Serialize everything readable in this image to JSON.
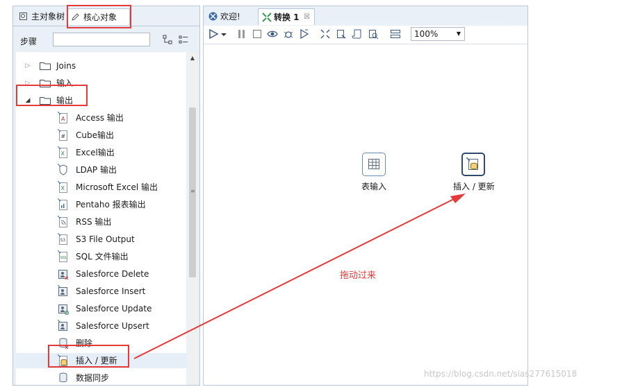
{
  "left_panel": {
    "tabs": [
      {
        "label": "主对象树",
        "icon": "tree-icon"
      },
      {
        "label": "核心对象",
        "icon": "pencil-icon"
      }
    ],
    "steps_label": "步骤",
    "tree": [
      {
        "type": "folder",
        "label": "Joins",
        "expanded": false
      },
      {
        "type": "folder",
        "label": "输入",
        "expanded": false
      },
      {
        "type": "folder",
        "label": "输出",
        "expanded": true
      },
      {
        "type": "step",
        "label": "Access 输出",
        "icon": "access-output-icon"
      },
      {
        "type": "step",
        "label": "Cube输出",
        "icon": "cube-output-icon"
      },
      {
        "type": "step",
        "label": "Excel输出",
        "icon": "excel-output-icon"
      },
      {
        "type": "step",
        "label": "LDAP 输出",
        "icon": "ldap-output-icon"
      },
      {
        "type": "step",
        "label": "Microsoft Excel 输出",
        "icon": "ms-excel-output-icon"
      },
      {
        "type": "step",
        "label": "Pentaho 报表输出",
        "icon": "report-output-icon"
      },
      {
        "type": "step",
        "label": "RSS 输出",
        "icon": "rss-output-icon"
      },
      {
        "type": "step",
        "label": "S3 File Output",
        "icon": "s3-output-icon"
      },
      {
        "type": "step",
        "label": "SQL 文件输出",
        "icon": "sql-output-icon"
      },
      {
        "type": "step",
        "label": "Salesforce Delete",
        "icon": "salesforce-delete-icon"
      },
      {
        "type": "step",
        "label": "Salesforce Insert",
        "icon": "salesforce-insert-icon"
      },
      {
        "type": "step",
        "label": "Salesforce Update",
        "icon": "salesforce-update-icon"
      },
      {
        "type": "step",
        "label": "Salesforce Upsert",
        "icon": "salesforce-upsert-icon"
      },
      {
        "type": "step",
        "label": "删除",
        "icon": "delete-step-icon"
      },
      {
        "type": "step",
        "label": "插入 / 更新",
        "icon": "insert-update-icon"
      },
      {
        "type": "step",
        "label": "数据同步",
        "icon": "sync-icon"
      }
    ]
  },
  "right_panel": {
    "tabs": [
      {
        "label": "欢迎!",
        "icon": "spoon-icon"
      },
      {
        "label": "转换 1",
        "icon": "transformation-icon",
        "close": "☒"
      }
    ],
    "zoom": "100%",
    "nodes": [
      {
        "label": "表输入",
        "icon": "table-input-icon"
      },
      {
        "label": "插入 / 更新",
        "icon": "insert-update-icon"
      }
    ]
  },
  "annotation": "拖动过来",
  "watermark": "https://blog.csdn.net/sias277615018",
  "colors": {
    "highlight": "#e5393a",
    "panel": "#eaf0f7",
    "border": "#b9c6d6"
  }
}
